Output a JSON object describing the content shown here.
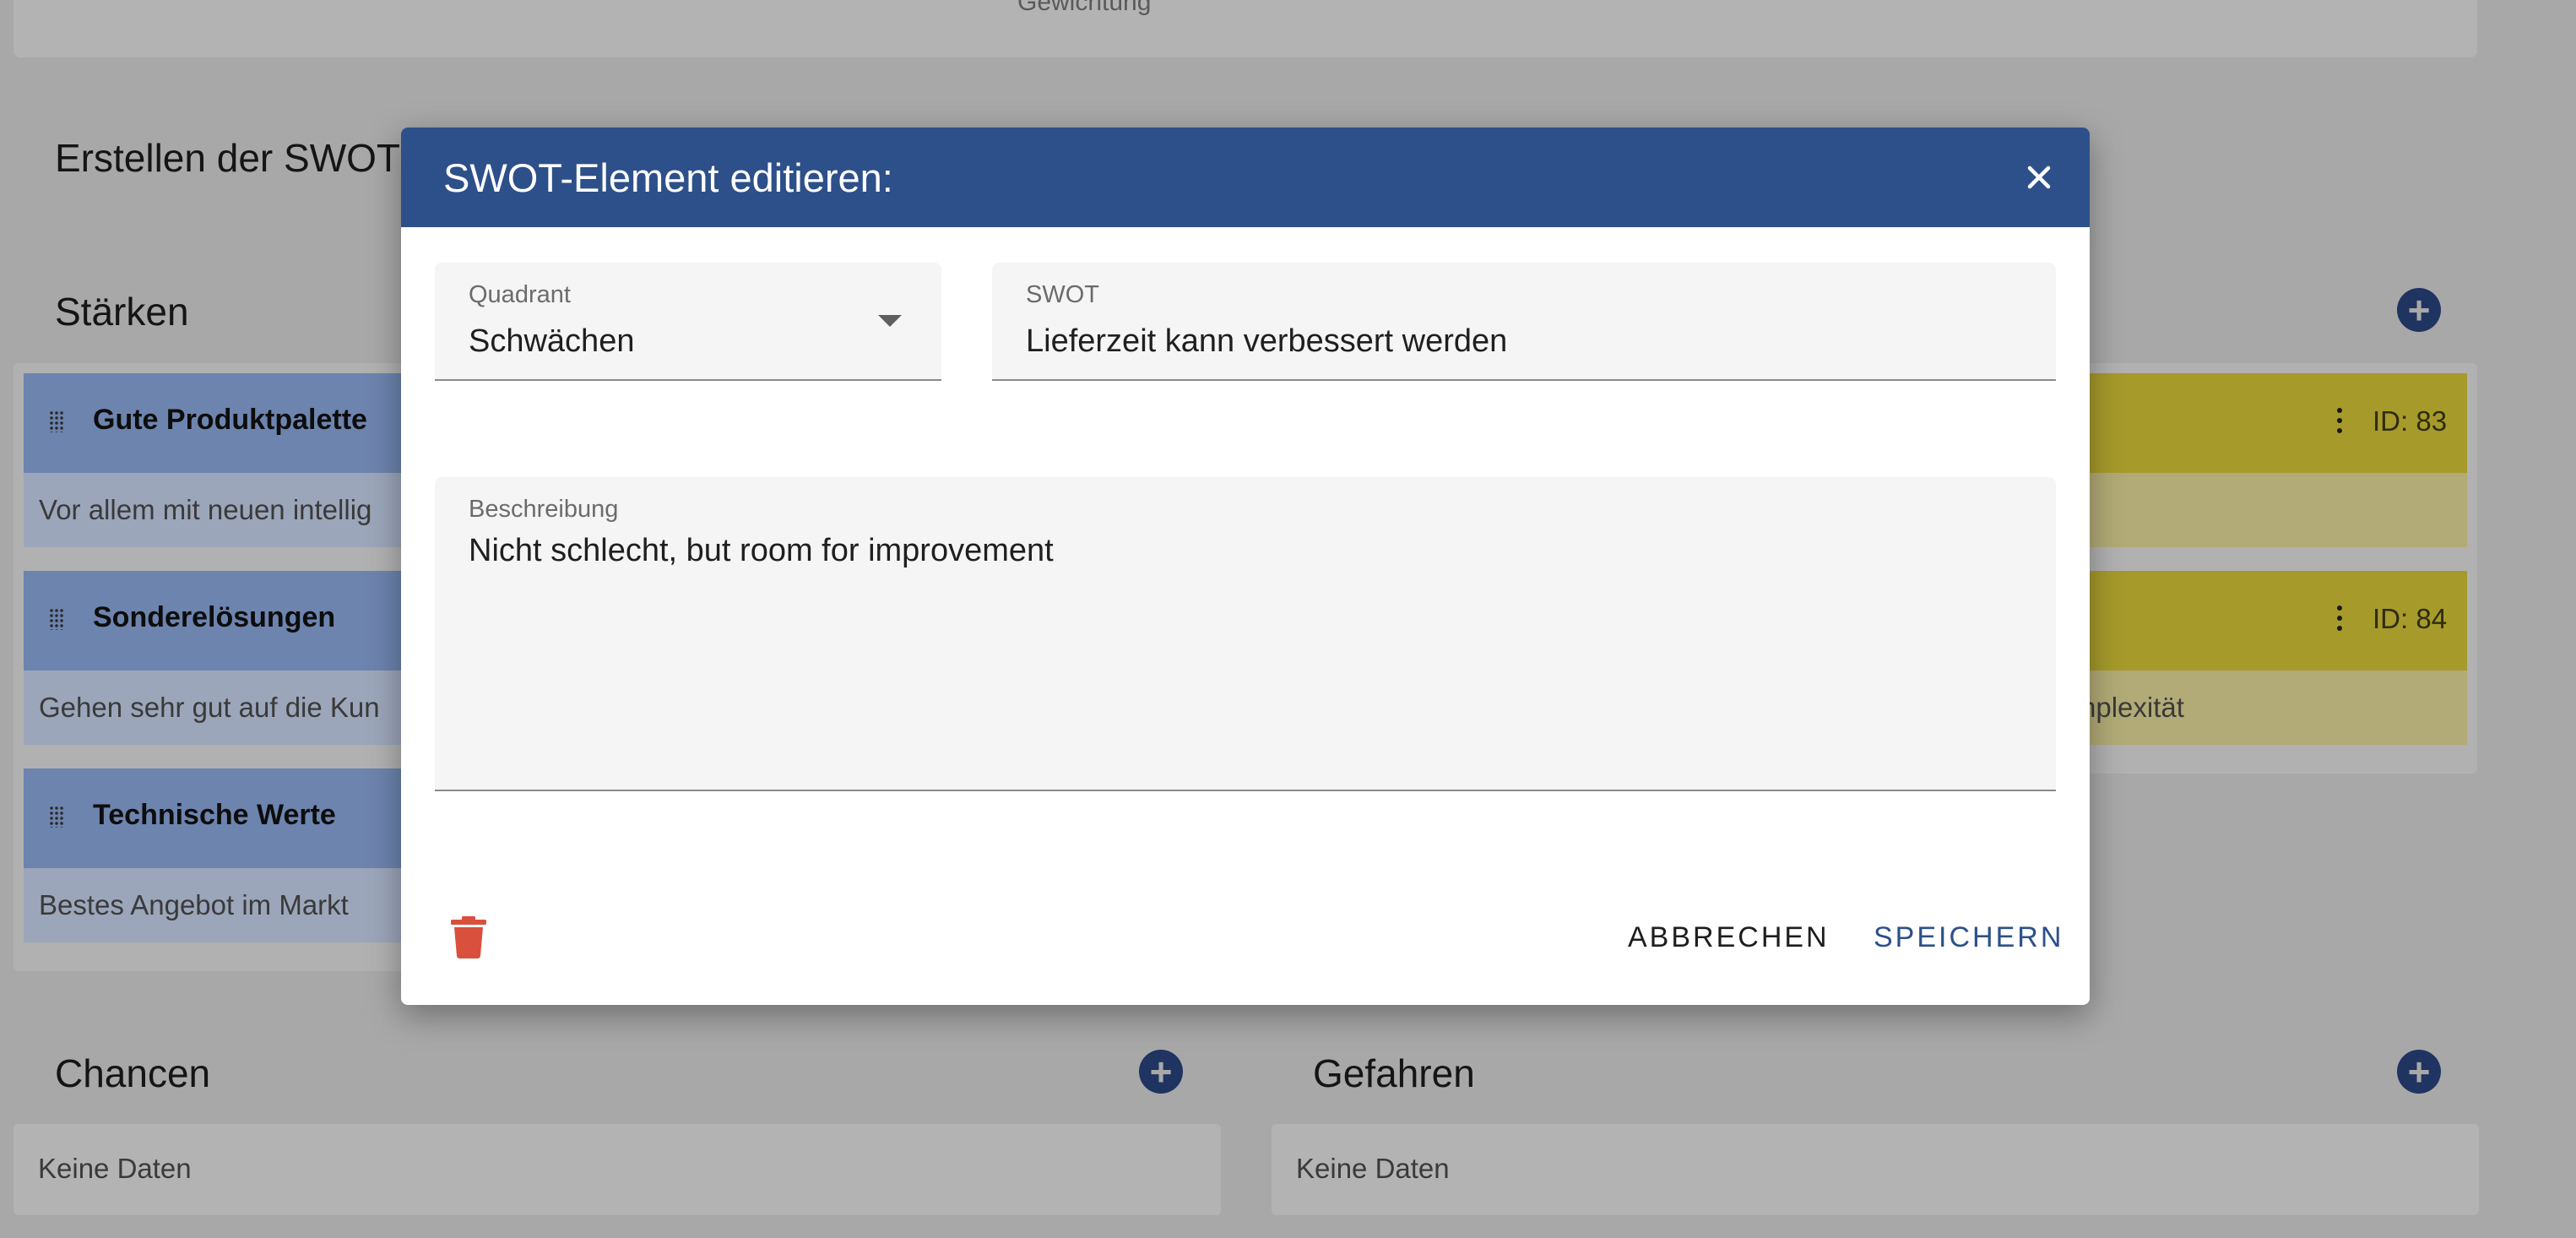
{
  "background": {
    "top_card_text": "Gewichtung",
    "page_heading": "Erstellen der SWOT",
    "strengths": {
      "title": "Stärken",
      "items": [
        {
          "title": "Gute Produktpalette",
          "description": "Vor allem mit neuen intellig"
        },
        {
          "title": "Sonderelösungen",
          "description": "Gehen sehr gut auf die Kun"
        },
        {
          "title": "Technische Werte",
          "description": "Bestes Angebot im Markt"
        }
      ]
    },
    "weaknesses": {
      "items": [
        {
          "id_label": "ID: 83",
          "description": ""
        },
        {
          "id_label": "ID: 84",
          "description": "nplexität"
        }
      ]
    },
    "opportunities": {
      "title": "Chancen",
      "empty_text": "Keine Daten"
    },
    "threats": {
      "title": "Gefahren",
      "empty_text": "Keine Daten"
    }
  },
  "dialog": {
    "title": "SWOT-Element editieren:",
    "quadrant": {
      "label": "Quadrant",
      "value": "Schwächen"
    },
    "swot": {
      "label": "SWOT",
      "value": "Lieferzeit kann verbessert werden"
    },
    "description": {
      "label": "Beschreibung",
      "value": "Nicht schlecht, but room for improvement"
    },
    "cancel_label": "ABBRECHEN",
    "save_label": "SPEICHERN"
  },
  "colors": {
    "dialog_header": "#2d508a",
    "accent": "#2d508a",
    "delete": "#d9503c",
    "strength_item": "#6d84ae",
    "weakness_item": "#a69a2b"
  },
  "icons": [
    "drag-handle-icon",
    "more-vert-icon",
    "plus-circle-icon",
    "close-icon",
    "chevron-down-icon",
    "trash-icon"
  ]
}
